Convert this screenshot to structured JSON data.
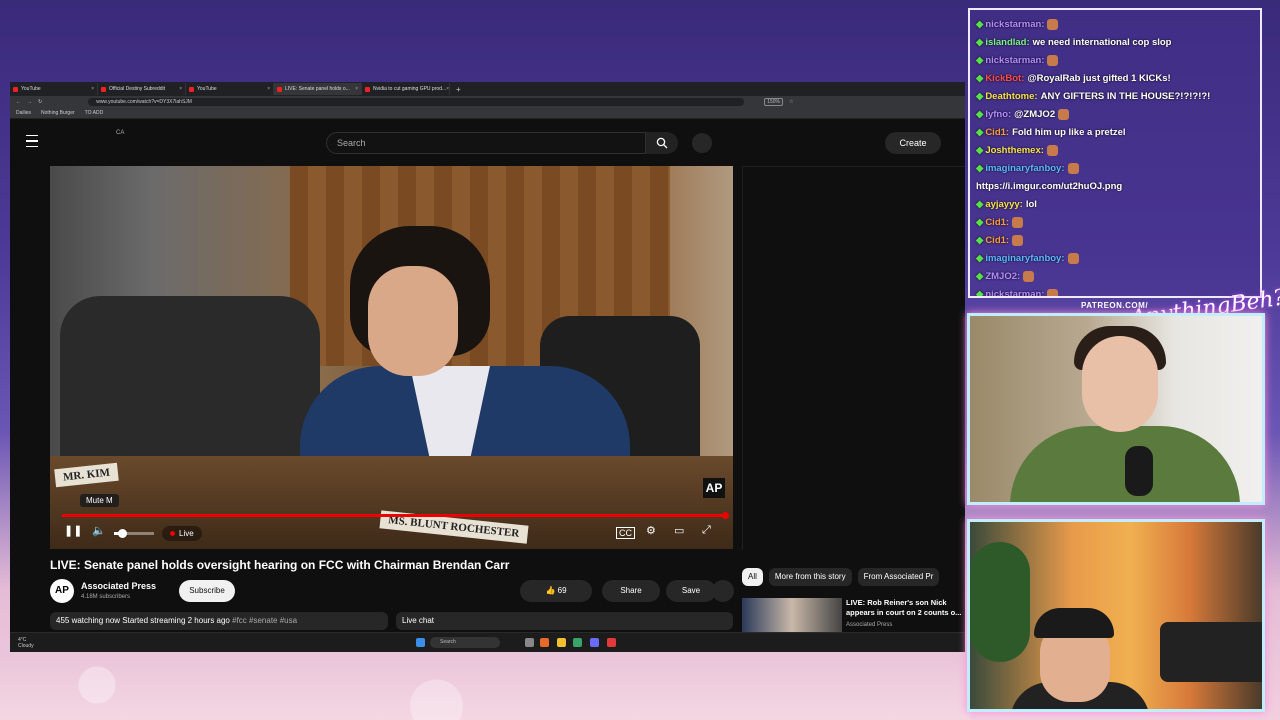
{
  "browser": {
    "tabs": [
      {
        "label": "YouTube",
        "active": false
      },
      {
        "label": "Official Destiny Subreddit",
        "active": false
      },
      {
        "label": "YouTube",
        "active": false
      },
      {
        "label": "LIVE: Senate panel holds o...",
        "active": true
      },
      {
        "label": "Nvidia to cut gaming GPU prod...",
        "active": false
      }
    ],
    "url": "www.youtube.com/watch?v=DY3X7lahSJM",
    "zoom": "150%",
    "bookmarks": [
      "Dailies",
      "Nothing Burger",
      "TO ADD"
    ]
  },
  "youtube": {
    "country_code": "CA",
    "search_placeholder": "Search",
    "create_label": "Create",
    "player": {
      "tooltip": "Mute  M",
      "live_label": "Live",
      "nameplate_left": "MR. KIM",
      "nameplate_right": "MS. BLUNT ROCHESTER",
      "watermark": "AP",
      "progress_fraction": 1.0,
      "volume_fraction": 0.2
    },
    "video_title": "LIVE: Senate panel holds oversight hearing on FCC with Chairman Brendan Carr",
    "channel": {
      "avatar": "AP",
      "name": "Associated Press",
      "subscribers": "4.18M subscribers"
    },
    "subscribe_label": "Subscribe",
    "likes": "69",
    "share_label": "Share",
    "save_label": "Save",
    "description": {
      "stats": "455 watching now  Started streaming 2 hours ago",
      "tags": "#fcc #senate #usa"
    },
    "live_chat_label": "Live chat",
    "chips": [
      "All",
      "More from this story",
      "From Associated Pr"
    ],
    "recommendation": {
      "title": "LIVE: Rob Reiner's son Nick appears in court on 2 counts o...",
      "channel": "Associated Press"
    }
  },
  "taskbar": {
    "weather_temp": "4°C",
    "weather_desc": "Cloudy",
    "search_label": "Search"
  },
  "chat": {
    "messages": [
      {
        "user": "nickstarman:",
        "text": "",
        "color": "purple",
        "emote": true
      },
      {
        "user": "islandlad:",
        "text": "we need international cop slop",
        "color": "green",
        "emote": false
      },
      {
        "user": "nickstarman:",
        "text": "",
        "color": "purple",
        "emote": true
      },
      {
        "user": "KickBot:",
        "text": "@RoyalRab just gifted 1 KICKs!",
        "color": "red",
        "emote": false
      },
      {
        "user": "Deathtome:",
        "text": "ANY GIFTERS IN THE HOUSE?!?!?!?!",
        "color": "yellow",
        "emote": false
      },
      {
        "user": "lyfno:",
        "text": "@ZMJO2",
        "color": "purple",
        "emote": true
      },
      {
        "user": "Cid1:",
        "text": "Fold him up like a pretzel",
        "color": "orange",
        "emote": false
      },
      {
        "user": "Joshthemex:",
        "text": "",
        "color": "yellow",
        "emote": true
      },
      {
        "user": "imaginaryfanboy:",
        "text": "",
        "color": "blue",
        "emote": true
      },
      {
        "user": "",
        "text": "https://i.imgur.com/ut2huOJ.png",
        "color": "green",
        "emote": false
      },
      {
        "user": "ayjayyy:",
        "text": "lol",
        "color": "yellow",
        "emote": false
      },
      {
        "user": "Cid1:",
        "text": "",
        "color": "orange",
        "emote": true
      },
      {
        "user": "Cid1:",
        "text": "",
        "color": "orange",
        "emote": true
      },
      {
        "user": "imaginaryfanboy:",
        "text": "",
        "color": "blue",
        "emote": true
      },
      {
        "user": "ZMJO2:",
        "text": "",
        "color": "purple",
        "emote": true
      },
      {
        "user": "nickstarman:",
        "text": "",
        "color": "purple",
        "emote": true
      }
    ]
  },
  "overlay": {
    "patreon": "PATREON.COM/",
    "logo_script": "AnythingBeh?"
  }
}
